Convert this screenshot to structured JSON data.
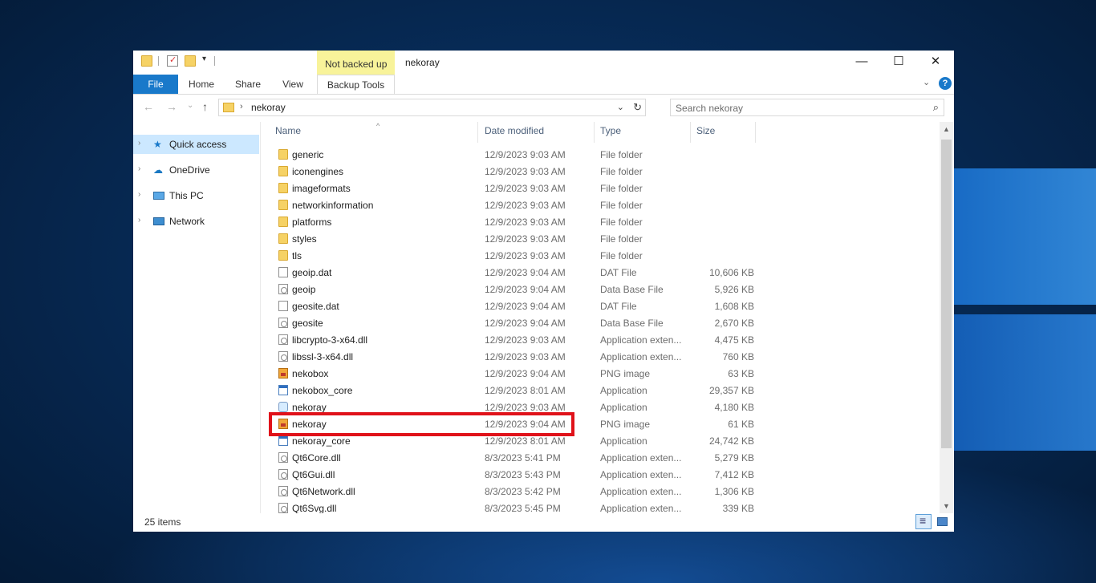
{
  "titlebar": {
    "ribbon_context_tab": "Not backed up",
    "title": "nekoray",
    "minimize": "—",
    "maximize": "☐",
    "close": "✕"
  },
  "ribbon": {
    "tabs": [
      "File",
      "Home",
      "Share",
      "View"
    ],
    "context_tab": "Backup Tools",
    "help": "?"
  },
  "address": {
    "back": "←",
    "forward": "→",
    "recent": "⌄",
    "up": "↑",
    "crumb": "nekoray",
    "search_placeholder": "Search nekoray"
  },
  "sidebar": {
    "items": [
      {
        "label": "Quick access",
        "icon": "star-icon",
        "selected": true
      },
      {
        "label": "OneDrive",
        "icon": "cloud-icon",
        "selected": false
      },
      {
        "label": "This PC",
        "icon": "computer-icon",
        "selected": false
      },
      {
        "label": "Network",
        "icon": "network-icon",
        "selected": false
      }
    ]
  },
  "columns": [
    "Name",
    "Date modified",
    "Type",
    "Size"
  ],
  "files": [
    {
      "name": "generic",
      "date": "12/9/2023 9:03 AM",
      "type": "File folder",
      "size": "",
      "icon": "folder"
    },
    {
      "name": "iconengines",
      "date": "12/9/2023 9:03 AM",
      "type": "File folder",
      "size": "",
      "icon": "folder"
    },
    {
      "name": "imageformats",
      "date": "12/9/2023 9:03 AM",
      "type": "File folder",
      "size": "",
      "icon": "folder"
    },
    {
      "name": "networkinformation",
      "date": "12/9/2023 9:03 AM",
      "type": "File folder",
      "size": "",
      "icon": "folder"
    },
    {
      "name": "platforms",
      "date": "12/9/2023 9:03 AM",
      "type": "File folder",
      "size": "",
      "icon": "folder"
    },
    {
      "name": "styles",
      "date": "12/9/2023 9:03 AM",
      "type": "File folder",
      "size": "",
      "icon": "folder"
    },
    {
      "name": "tls",
      "date": "12/9/2023 9:03 AM",
      "type": "File folder",
      "size": "",
      "icon": "folder"
    },
    {
      "name": "geoip.dat",
      "date": "12/9/2023 9:04 AM",
      "type": "DAT File",
      "size": "10,606 KB",
      "icon": "file"
    },
    {
      "name": "geoip",
      "date": "12/9/2023 9:04 AM",
      "type": "Data Base File",
      "size": "5,926 KB",
      "icon": "dll"
    },
    {
      "name": "geosite.dat",
      "date": "12/9/2023 9:04 AM",
      "type": "DAT File",
      "size": "1,608 KB",
      "icon": "file"
    },
    {
      "name": "geosite",
      "date": "12/9/2023 9:04 AM",
      "type": "Data Base File",
      "size": "2,670 KB",
      "icon": "dll"
    },
    {
      "name": "libcrypto-3-x64.dll",
      "date": "12/9/2023 9:03 AM",
      "type": "Application exten...",
      "size": "4,475 KB",
      "icon": "dll"
    },
    {
      "name": "libssl-3-x64.dll",
      "date": "12/9/2023 9:03 AM",
      "type": "Application exten...",
      "size": "760 KB",
      "icon": "dll"
    },
    {
      "name": "nekobox",
      "date": "12/9/2023 9:04 AM",
      "type": "PNG image",
      "size": "63 KB",
      "icon": "png"
    },
    {
      "name": "nekobox_core",
      "date": "12/9/2023 8:01 AM",
      "type": "Application",
      "size": "29,357 KB",
      "icon": "app"
    },
    {
      "name": "nekoray",
      "date": "12/9/2023 9:03 AM",
      "type": "Application",
      "size": "4,180 KB",
      "icon": "neko"
    },
    {
      "name": "nekoray",
      "date": "12/9/2023 9:04 AM",
      "type": "PNG image",
      "size": "61 KB",
      "icon": "png"
    },
    {
      "name": "nekoray_core",
      "date": "12/9/2023 8:01 AM",
      "type": "Application",
      "size": "24,742 KB",
      "icon": "app"
    },
    {
      "name": "Qt6Core.dll",
      "date": "8/3/2023 5:41 PM",
      "type": "Application exten...",
      "size": "5,279 KB",
      "icon": "dll"
    },
    {
      "name": "Qt6Gui.dll",
      "date": "8/3/2023 5:43 PM",
      "type": "Application exten...",
      "size": "7,412 KB",
      "icon": "dll"
    },
    {
      "name": "Qt6Network.dll",
      "date": "8/3/2023 5:42 PM",
      "type": "Application exten...",
      "size": "1,306 KB",
      "icon": "dll"
    },
    {
      "name": "Qt6Svg.dll",
      "date": "8/3/2023 5:45 PM",
      "type": "Application exten...",
      "size": "339 KB",
      "icon": "dll"
    }
  ],
  "status": {
    "item_count": "25 items"
  },
  "colors": {
    "file_tab": "#1979ca",
    "selection": "#cce8ff",
    "context_tab": "#f8f39a",
    "highlight": "#e0121a"
  }
}
